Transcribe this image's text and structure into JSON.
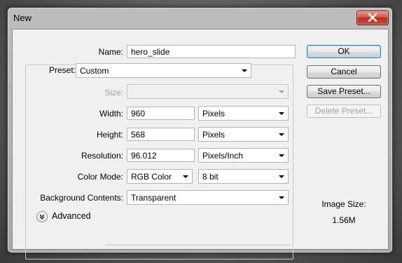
{
  "window": {
    "title": "New"
  },
  "form": {
    "name_label": "Name:",
    "name_value": "hero_slide",
    "preset_label": "Preset:",
    "preset_value": "Custom",
    "size_label": "Size:",
    "size_value": "",
    "width_label": "Width:",
    "width_value": "960",
    "width_unit": "Pixels",
    "height_label": "Height:",
    "height_value": "568",
    "height_unit": "Pixels",
    "resolution_label": "Resolution:",
    "resolution_value": "96.012",
    "resolution_unit": "Pixels/Inch",
    "color_mode_label": "Color Mode:",
    "color_mode_value": "RGB Color",
    "bit_depth_value": "8 bit",
    "background_label": "Background Contents:",
    "background_value": "Transparent",
    "advanced_label": "Advanced"
  },
  "buttons": {
    "ok": "OK",
    "cancel": "Cancel",
    "save_preset": "Save Preset...",
    "delete_preset": "Delete Preset..."
  },
  "image_size": {
    "label": "Image Size:",
    "value": "1.56M"
  },
  "colors": {
    "close_button": "#c84a3c",
    "default_button_border": "#3c7fb1",
    "dialog_background": "#f0f0f0"
  },
  "icons": [
    "close-icon",
    "chevron-down-icon",
    "expand-double-chevron-icon"
  ]
}
